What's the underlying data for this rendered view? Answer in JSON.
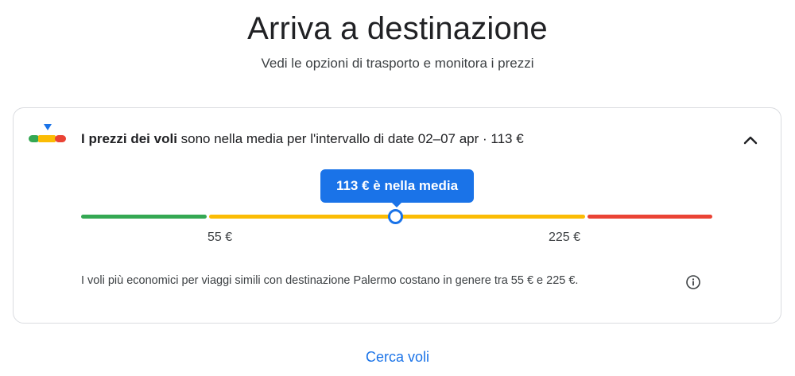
{
  "header": {
    "title": "Arriva a destinazione",
    "subtitle": "Vedi le opzioni di trasporto e monitora i prezzi"
  },
  "price_insight": {
    "headline_bold": "I prezzi dei voli",
    "headline_rest": " sono nella media per l'intervallo di date 02–07 apr · 113 €",
    "bubble_label": "113 € è nella media",
    "current_price": 113,
    "low_label": "55 €",
    "high_label": "225 €",
    "range_low": 55,
    "range_high": 225,
    "description": "I voli più economici per viaggi simili con destinazione Palermo costano in genere tra 55 € e 225 €."
  },
  "actions": {
    "search_flights": "Cerca voli"
  },
  "colors": {
    "low": "#34a853",
    "typical": "#fbbc04",
    "high": "#ea4335",
    "accent": "#1a73e8"
  },
  "icons": {
    "gauge": "price-gauge-icon",
    "collapse": "chevron-up-icon",
    "info": "info-icon"
  }
}
